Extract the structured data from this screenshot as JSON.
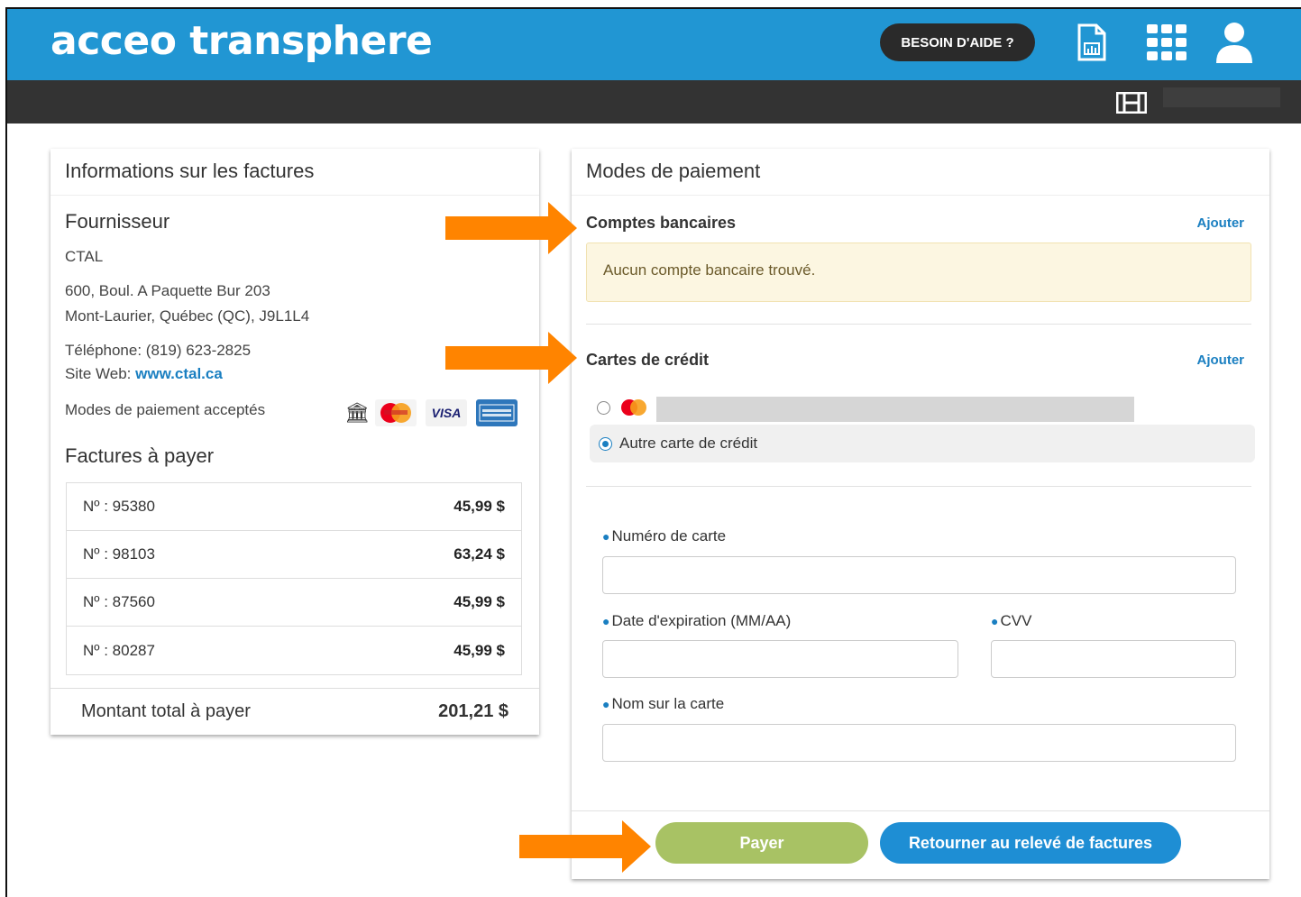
{
  "header": {
    "logo": "acceo transphere",
    "help_label": "BESOIN D'AIDE ?"
  },
  "invoice_info": {
    "title": "Informations sur les factures",
    "supplier_heading": "Fournisseur",
    "supplier_name": "CTAL",
    "address_line1": "600, Boul. A Paquette Bur 203",
    "address_line2": "Mont-Laurier, Québec (QC), J9L1L4",
    "phone": "Téléphone: (819) 623-2825",
    "website_label": "Site Web:",
    "website": "www.ctal.ca",
    "accepted_methods_label": "Modes de paiement acceptés",
    "invoices_heading": "Factures à payer",
    "invoices": [
      {
        "number": "Nº : 95380",
        "amount": "45,99 $"
      },
      {
        "number": "Nº : 98103",
        "amount": "63,24 $"
      },
      {
        "number": "Nº : 87560",
        "amount": "45,99 $"
      },
      {
        "number": "Nº : 80287",
        "amount": "45,99 $"
      }
    ],
    "total_label": "Montant total à payer",
    "total_amount": "201,21 $"
  },
  "payment": {
    "title": "Modes de paiement",
    "bank_heading": "Comptes bancaires",
    "bank_add": "Ajouter",
    "bank_empty": "Aucun compte bancaire trouvé.",
    "credit_heading": "Cartes de crédit",
    "credit_add": "Ajouter",
    "other_card": "Autre carte de crédit",
    "card_number_label": "Numéro de carte",
    "expiry_label": "Date d'expiration (MM/AA)",
    "cvv_label": "CVV",
    "name_label": "Nom sur la carte",
    "pay_button": "Payer",
    "back_button": "Retourner au relevé de factures"
  },
  "colors": {
    "header_blue": "#2196d3",
    "dark_bar": "#333333",
    "pay_green": "#a8c264",
    "action_blue": "#1e8ed4",
    "arrow_orange": "#ff8400"
  }
}
